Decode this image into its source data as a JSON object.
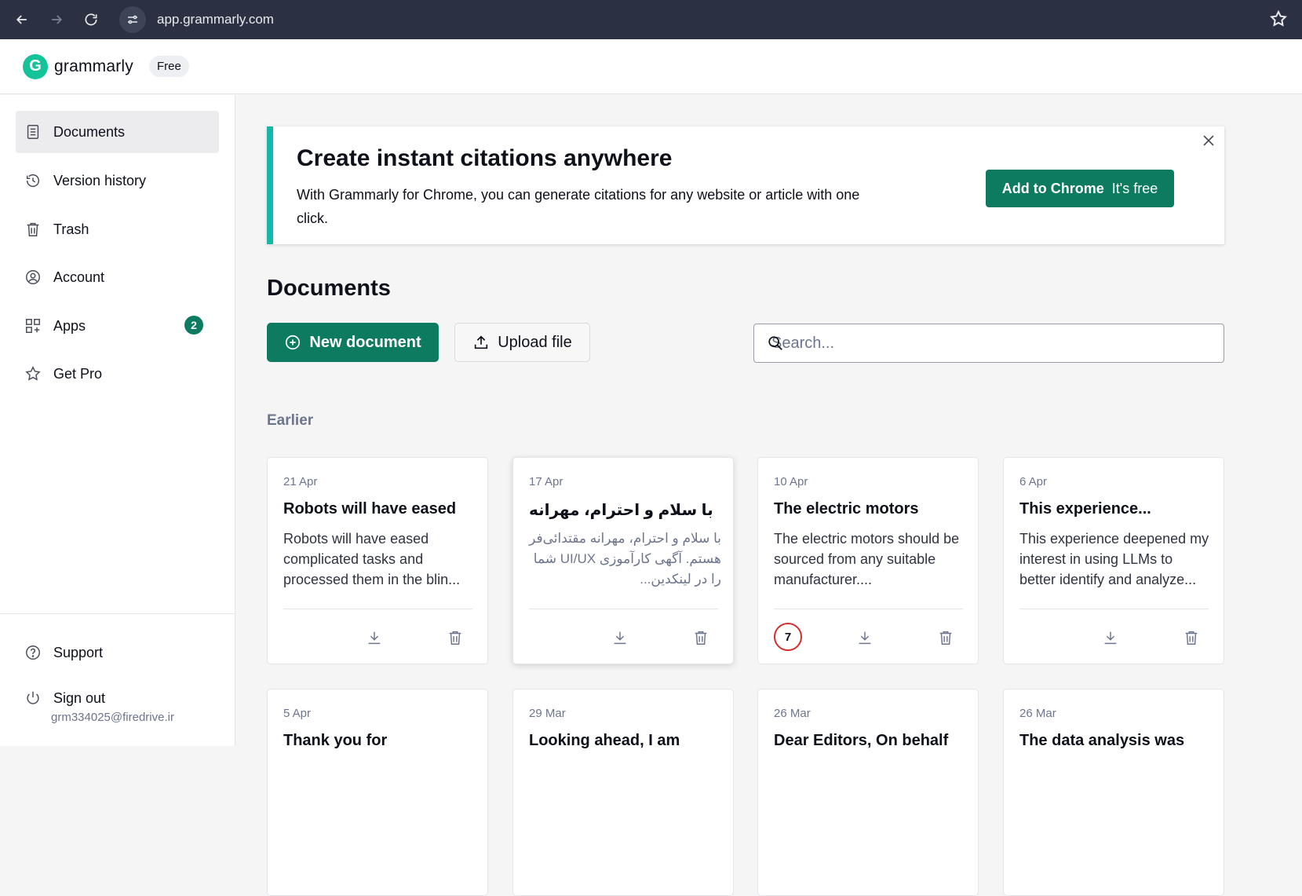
{
  "browser": {
    "url": "app.grammarly.com"
  },
  "header": {
    "logo_text": "grammarly",
    "plan_badge": "Free"
  },
  "sidebar": {
    "items": [
      {
        "label": "Documents",
        "icon": "document-icon",
        "active": true
      },
      {
        "label": "Version history",
        "icon": "history-icon"
      },
      {
        "label": "Trash",
        "icon": "trash-icon"
      },
      {
        "label": "Account",
        "icon": "account-icon"
      },
      {
        "label": "Apps",
        "icon": "apps-icon",
        "badge": "2"
      },
      {
        "label": "Get Pro",
        "icon": "star-icon"
      }
    ],
    "support_label": "Support",
    "signout_label": "Sign out",
    "user_email": "grm334025@firedrive.ir"
  },
  "promo": {
    "title": "Create instant citations anywhere",
    "description": "With Grammarly for Chrome, you can generate citations for any website or article with one click.",
    "cta_bold": "Add to Chrome",
    "cta_light": "It's free"
  },
  "main": {
    "title": "Documents",
    "new_document_label": "New document",
    "upload_label": "Upload file",
    "search_placeholder": "Search...",
    "group_label": "Earlier"
  },
  "documents": [
    {
      "date": "21 Apr",
      "title": "Robots will have eased",
      "preview": "Robots will have eased complicated tasks and processed them in the blin..."
    },
    {
      "date": "17 Apr",
      "title": "با سلام و احترام، مهرانه",
      "preview": "با سلام و احترام، مهرانه مقتدائی‌فر هستم. آگهی کارآموزی UI/UX شما را در لینکدین...",
      "rtl": true
    },
    {
      "date": "10 Apr",
      "title": "The electric motors",
      "preview": "The electric motors should be sourced from any suitable manufacturer....",
      "score": "7"
    },
    {
      "date": "6 Apr",
      "title": "This experience...",
      "preview": "This experience deepened my interest in using LLMs to better identify and analyze..."
    },
    {
      "date": "5 Apr",
      "title": "Thank you for"
    },
    {
      "date": "29 Mar",
      "title": "Looking ahead, I am"
    },
    {
      "date": "26 Mar",
      "title": "Dear Editors, On behalf"
    },
    {
      "date": "26 Mar",
      "title": "The data analysis was"
    }
  ]
}
